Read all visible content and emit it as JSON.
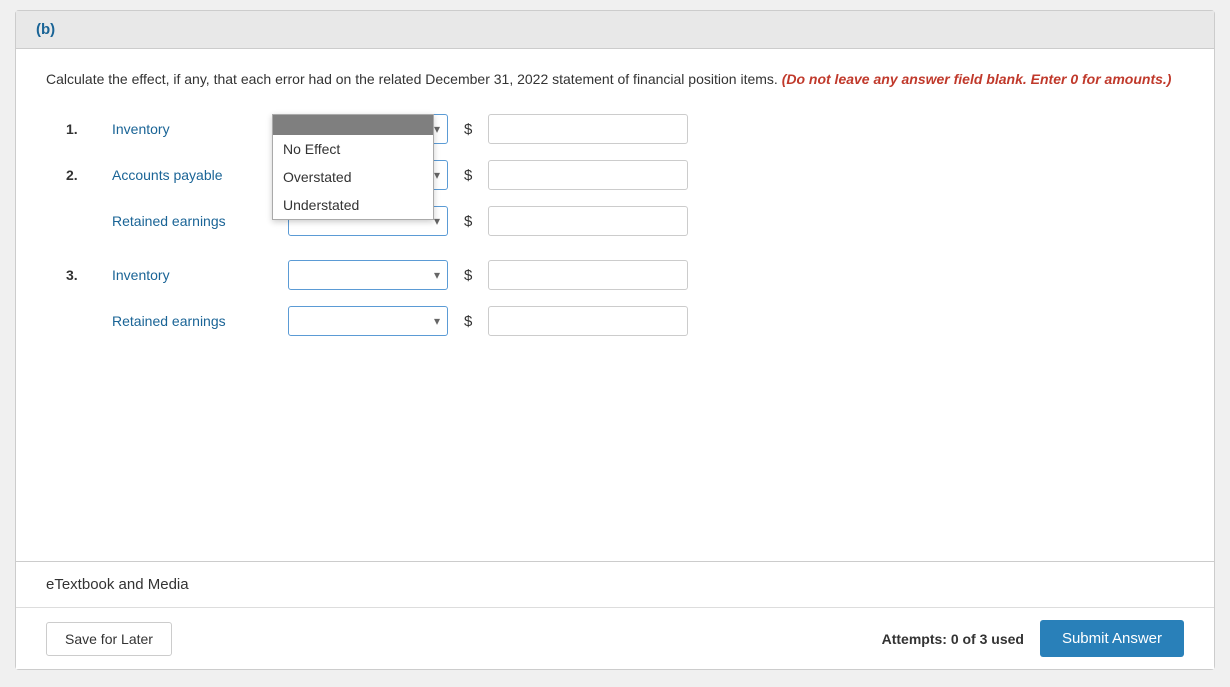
{
  "section_label": "(b)",
  "instruction": {
    "main": "Calculate the effect, if any, that each error had on the related December 31, 2022 statement of financial position items.",
    "highlight": "(Do not leave any answer field blank. Enter 0 for amounts.)"
  },
  "dropdown_options": [
    {
      "value": "",
      "label": ""
    },
    {
      "value": "no_effect",
      "label": "No Effect"
    },
    {
      "value": "overstated",
      "label": "Overstated"
    },
    {
      "value": "understated",
      "label": "Understated"
    }
  ],
  "open_dropdown": {
    "options": [
      "No Effect",
      "Overstated",
      "Understated"
    ]
  },
  "rows": [
    {
      "number": "1.",
      "label": "Inventory",
      "has_number": true,
      "dropdown_id": "dd1",
      "amount_id": "amt1",
      "is_open": true
    },
    {
      "number": "2.",
      "label": "Accounts payable",
      "has_number": true,
      "dropdown_id": "dd2",
      "amount_id": "amt2",
      "is_open": false
    },
    {
      "number": "",
      "label": "Retained earnings",
      "has_number": false,
      "dropdown_id": "dd3",
      "amount_id": "amt3",
      "is_open": false
    },
    {
      "number": "3.",
      "label": "Inventory",
      "has_number": true,
      "dropdown_id": "dd4",
      "amount_id": "amt4",
      "is_open": false
    },
    {
      "number": "",
      "label": "Retained earnings",
      "has_number": false,
      "dropdown_id": "dd5",
      "amount_id": "amt5",
      "is_open": false
    }
  ],
  "footer": {
    "etextbook_label": "eTextbook and Media",
    "save_later": "Save for Later",
    "attempts_text": "Attempts: 0 of 3 used",
    "submit": "Submit Answer"
  }
}
